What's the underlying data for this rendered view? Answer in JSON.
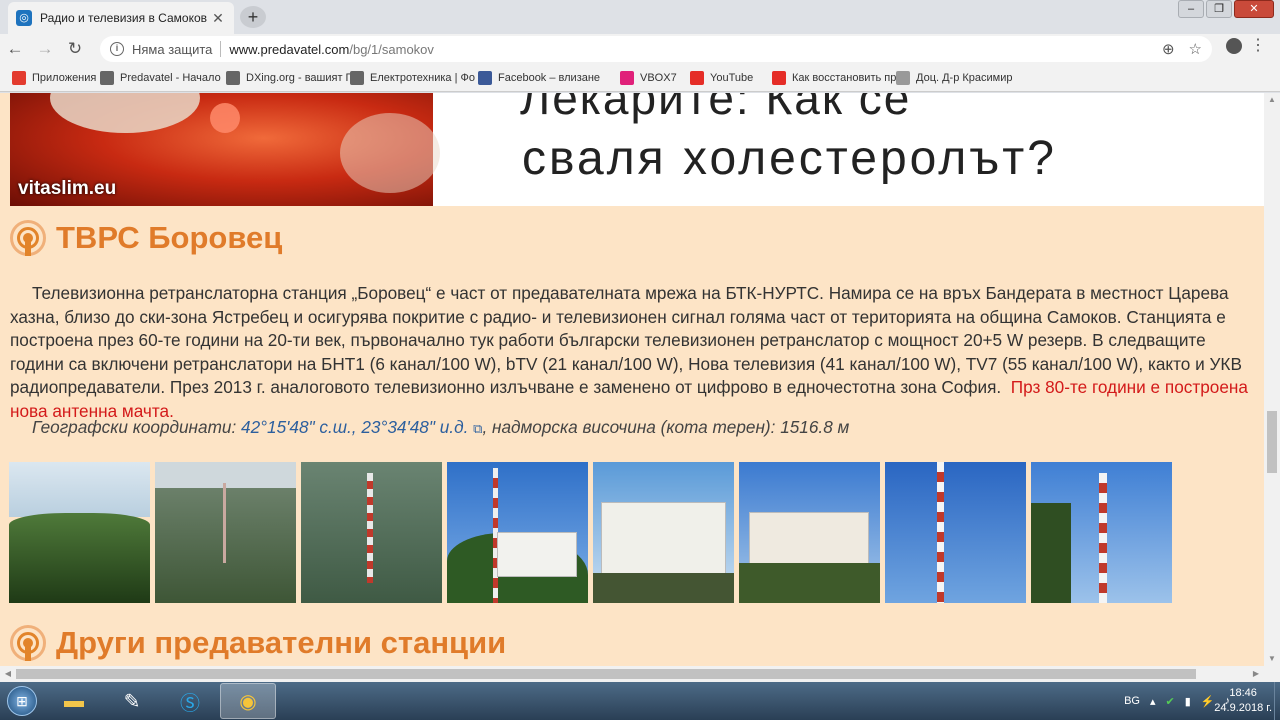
{
  "browser": {
    "tab_title": "Радио и телевизия в Самоков –",
    "tab_favicon": "predavatel-favicon",
    "newtab_label": "+",
    "window_controls": [
      "–",
      "❐",
      "✕"
    ],
    "security_label": "Няма защита",
    "url_host": "www.predavatel.com",
    "url_path": "/bg/1/samokov",
    "icons": [
      "back-icon",
      "forward-icon",
      "reload-icon",
      "info-icon",
      "zoom-icon",
      "star-icon",
      "profile-icon",
      "menu-icon"
    ]
  },
  "bookmarks": [
    {
      "label": "Приложения",
      "color": "#e33b2e"
    },
    {
      "label": "Predavatel - Начало",
      "color": "#666666"
    },
    {
      "label": "DXing.org - вашият Г",
      "color": "#666666"
    },
    {
      "label": "Електротехника | Фо",
      "color": "#666666"
    },
    {
      "label": "Facebook – влизане",
      "color": "#3b5998"
    },
    {
      "label": "VBOX7",
      "color": "#e0217a"
    },
    {
      "label": "YouTube",
      "color": "#e52d27"
    },
    {
      "label": "Как восстановить пр",
      "color": "#e52d27"
    },
    {
      "label": "Доц. Д-р Красимир",
      "color": "#999999"
    }
  ],
  "ad": {
    "brand": "vitaslim.eu",
    "line1": "Лекарите: Как се",
    "line2": "сваля холестеролът?"
  },
  "section1": {
    "heading": "ТВРС Боровец",
    "description": "Телевизионна ретранслаторна станция „Боровец“ е част от предавателната мрежа на БТК-НУРТС. Намира се на връх Бандерата в местност Царева хазна, близо до ски-зона Ястребец и осигурява покритие с радио- и телевизионен сигнал голяма част от територията на община Самоков. Станцията е построена през 60-те години на 20-ти век, първоначално тук работи български телевизионен ретранслатор с мощност 20+5 W резерв. В следващите години са включени ретранслатори на БНТ1 (6 канал/100 W), bTV (21 канал/100 W), Нова телевизия (41 канал/100 W), TV7 (55 канал/100 W), както и УКВ радиопредаватели. През 2013 г. аналоговото телевизионно излъчване е заменено от цифрово в едночестотна зона София.",
    "description_red": "Прз 80-те години е построена нова антенна мачта.",
    "coords_prefix": "Географски координати:",
    "coords_link": "42°15'48\" с.ш., 23°34'48\" и.д.",
    "coords_suffix": ", надморска височина (кота терен): 1516.8 м"
  },
  "section2": {
    "heading": "Други предавателни станции"
  },
  "taskbar": {
    "language": "BG",
    "time": "18:46",
    "date": "24.9.2018 г.",
    "apps": [
      "windows-explorer",
      "paint",
      "skype",
      "chrome"
    ]
  }
}
